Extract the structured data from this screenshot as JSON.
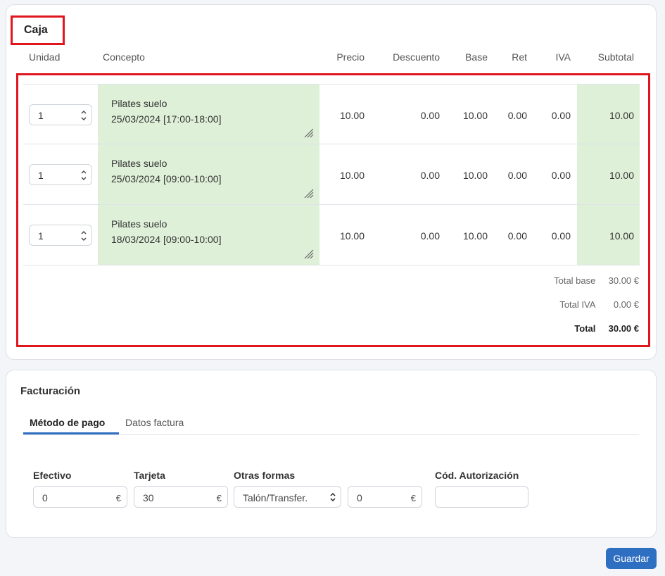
{
  "caja": {
    "title": "Caja",
    "headers": {
      "unidad": "Unidad",
      "concepto": "Concepto",
      "precio": "Precio",
      "descuento": "Descuento",
      "base": "Base",
      "ret": "Ret",
      "iva": "IVA",
      "subtotal": "Subtotal"
    },
    "rows": [
      {
        "unidad": "1",
        "concepto_1": "Pilates suelo",
        "concepto_2": "25/03/2024 [17:00-18:00]",
        "precio": "10.00",
        "descuento": "0.00",
        "base": "10.00",
        "ret": "0.00",
        "iva": "0.00",
        "subtotal": "10.00"
      },
      {
        "unidad": "1",
        "concepto_1": "Pilates suelo",
        "concepto_2": "25/03/2024 [09:00-10:00]",
        "precio": "10.00",
        "descuento": "0.00",
        "base": "10.00",
        "ret": "0.00",
        "iva": "0.00",
        "subtotal": "10.00"
      },
      {
        "unidad": "1",
        "concepto_1": "Pilates suelo",
        "concepto_2": "18/03/2024 [09:00-10:00]",
        "precio": "10.00",
        "descuento": "0.00",
        "base": "10.00",
        "ret": "0.00",
        "iva": "0.00",
        "subtotal": "10.00"
      }
    ],
    "totals": {
      "base_label": "Total base",
      "base_value": "30.00 €",
      "iva_label": "Total IVA",
      "iva_value": "0.00 €",
      "total_label": "Total",
      "total_value": "30.00 €"
    }
  },
  "facturacion": {
    "title": "Facturación",
    "tabs": {
      "active": "Método de pago",
      "inactive": "Datos factura"
    },
    "fields": {
      "efectivo_label": "Efectivo",
      "efectivo_value": "0",
      "tarjeta_label": "Tarjeta",
      "tarjeta_value": "30",
      "otras_label": "Otras formas",
      "otras_select": "Talón/Transfer.",
      "otras_value": "0",
      "cod_label": "Cód. Autorización",
      "cod_value": "",
      "currency": "€"
    }
  },
  "actions": {
    "save_label": "Guardar"
  },
  "colors": {
    "accent": "#2f6fc1",
    "highlight": "#dff0d8",
    "annotation": "#e0161e"
  }
}
